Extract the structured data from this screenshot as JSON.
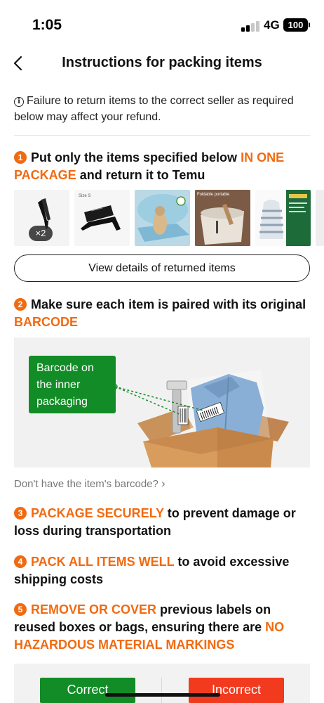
{
  "status_bar": {
    "time": "1:05",
    "network": "4G",
    "battery": "100"
  },
  "header": {
    "title": "Instructions for packing items"
  },
  "notice": {
    "text": "Failure to return items to the correct seller as required below may affect your refund."
  },
  "step1": {
    "number": "1",
    "text_a": "Put only the items specified below ",
    "highlight": "IN ONE PACKAGE",
    "text_b": " and return it to Temu"
  },
  "items": [
    {
      "icon": "tweezers",
      "quantity": "×2"
    },
    {
      "icon": "tablet-stand",
      "label": "Size S"
    },
    {
      "icon": "dog-cooling-mat"
    },
    {
      "icon": "foldable-bucket",
      "label": "Foldable portable"
    },
    {
      "icon": "striped-bag"
    },
    {
      "icon": "cut-off-item"
    }
  ],
  "details_button": {
    "label": "View details of returned items"
  },
  "step2": {
    "number": "2",
    "text_a": "Make sure each item is paired with its original ",
    "highlight": "BARCODE"
  },
  "barcode_callout": {
    "line1": "Barcode on",
    "line2": "the inner",
    "line3": "packaging"
  },
  "barcode_link": {
    "label": "Don't have the item's barcode?",
    "chevron": "›"
  },
  "step3": {
    "number": "3",
    "highlight": "PACKAGE SECURELY",
    "text": " to prevent damage or loss during transportation"
  },
  "step4": {
    "number": "4",
    "highlight": "PACK ALL ITEMS WELL",
    "text": " to avoid excessive shipping costs"
  },
  "step5": {
    "number": "5",
    "highlight_a": "REMOVE OR COVER",
    "text_a": " previous labels on reused boxes or bags, ensuring there are ",
    "highlight_b": "NO HAZARDOUS MATERIAL MARKINGS"
  },
  "example": {
    "correct_label": "Correct",
    "incorrect_label": "Incorrect"
  },
  "colors": {
    "accent": "#f26a10",
    "correct": "#128c26",
    "incorrect": "#f23a1e"
  }
}
